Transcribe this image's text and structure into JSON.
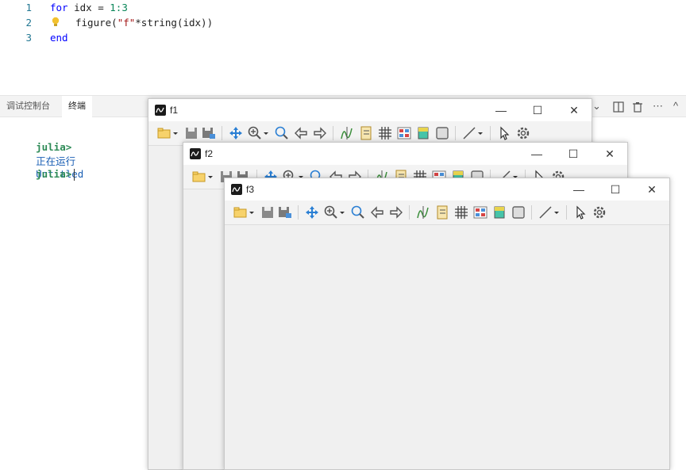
{
  "editor": {
    "lines": [
      {
        "num": "1",
        "kw1": "for",
        "rest": " idx = ",
        "n": "1:3"
      },
      {
        "num": "2",
        "fn": "figure(",
        "str": "\"f\"",
        "rest": "*string(idx))"
      },
      {
        "num": "3",
        "kw": "end"
      }
    ]
  },
  "panel": {
    "tabs": [
      "调试控制台",
      "终端"
    ],
    "active_tab": "终端",
    "terminal": {
      "prompt": "julia>",
      "running_label": "正在运行",
      "running_file": "Untitled"
    }
  },
  "windows": [
    {
      "title": "f1"
    },
    {
      "title": "f2"
    },
    {
      "title": "f3"
    }
  ],
  "colors": {
    "keyword": "#0000ff",
    "number": "#098658",
    "string": "#a31515",
    "prompt": "#2e8b57",
    "line_number": "#237893"
  }
}
